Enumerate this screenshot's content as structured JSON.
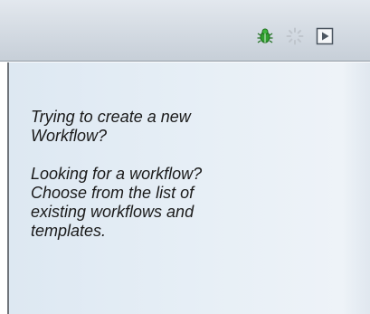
{
  "toolbar": {
    "icons": [
      "bug-icon",
      "spinner-icon",
      "run-icon"
    ],
    "colors": {
      "bug": "#2f9e2f",
      "spinner": "#bfc5cc",
      "run": "#4b5560"
    }
  },
  "panel": {
    "paragraphs": [
      "Trying to create a new\nWorkflow?",
      "Looking for a workflow?\nChoose from the list of\nexisting workflows and\ntemplates."
    ]
  }
}
